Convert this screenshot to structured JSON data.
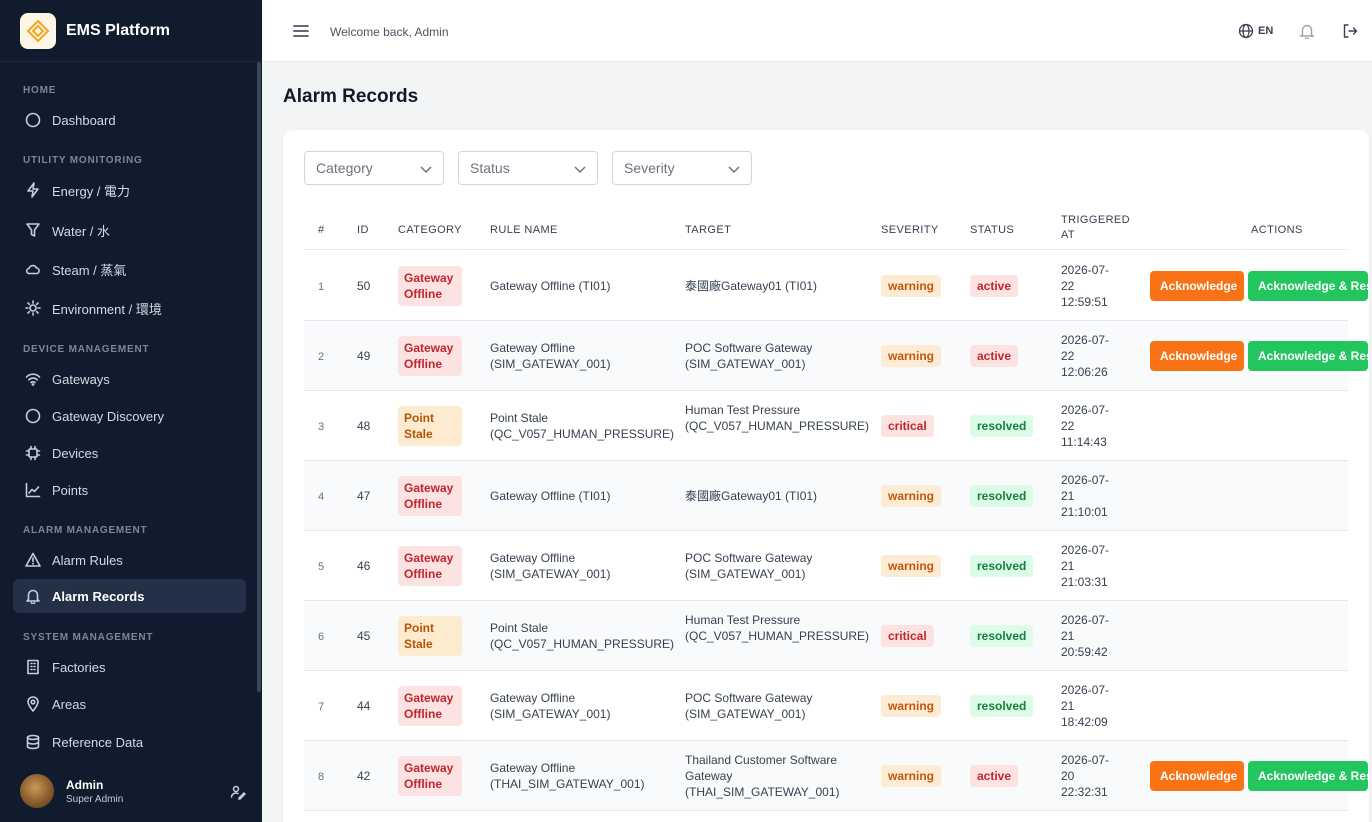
{
  "brand": {
    "name": "EMS Platform"
  },
  "sidebar": {
    "sections": [
      "HOME",
      "UTILITY MONITORING",
      "DEVICE MANAGEMENT",
      "ALARM MANAGEMENT",
      "SYSTEM MANAGEMENT"
    ],
    "items": [
      {
        "label": "Dashboard",
        "icon": "circle-icon"
      },
      {
        "label": "Energy / 電力",
        "icon": "lightning-icon"
      },
      {
        "label": "Water / 水",
        "icon": "filter-icon"
      },
      {
        "label": "Steam / 蒸氣",
        "icon": "cloud-icon"
      },
      {
        "label": "Environment / 環境",
        "icon": "sun-icon"
      },
      {
        "label": "Gateways",
        "icon": "wifi-icon"
      },
      {
        "label": "Gateway Discovery",
        "icon": "circle-icon"
      },
      {
        "label": "Devices",
        "icon": "chip-icon"
      },
      {
        "label": "Points",
        "icon": "chart-icon"
      },
      {
        "label": "Alarm Rules",
        "icon": "warning-icon"
      },
      {
        "label": "Alarm Records",
        "icon": "bell-icon",
        "active": true
      },
      {
        "label": "Factories",
        "icon": "building-icon"
      },
      {
        "label": "Areas",
        "icon": "pin-icon"
      },
      {
        "label": "Reference Data",
        "icon": "database-icon"
      }
    ]
  },
  "user": {
    "name": "Admin",
    "role": "Super Admin"
  },
  "topbar": {
    "welcome": "Welcome back, Admin",
    "lang": "EN"
  },
  "page": {
    "title": "Alarm Records"
  },
  "filters": {
    "category": "Category",
    "status": "Status",
    "severity": "Severity"
  },
  "table": {
    "headers": {
      "num": "#",
      "id": "ID",
      "category": "CATEGORY",
      "rule": "RULE NAME",
      "target": "TARGET",
      "severity": "SEVERITY",
      "status": "STATUS",
      "triggered": "TRIGGERED AT",
      "actions": "ACTIONS"
    },
    "actions": {
      "ack": "Acknowledge",
      "ack_resolve": "Acknowledge & Resolve"
    },
    "rows": [
      {
        "num": "1",
        "id": "50",
        "category": "Gateway Offline",
        "cat_tone": "red",
        "rule": "Gateway Offline (TI01)",
        "target": "泰國廠Gateway01 (TI01)",
        "severity": "warning",
        "status": "active",
        "triggered": "2026-07-22 12:59:51"
      },
      {
        "num": "2",
        "id": "49",
        "category": "Gateway Offline",
        "cat_tone": "red",
        "rule": "Gateway Offline (SIM_GATEWAY_001)",
        "target": "POC Software Gateway (SIM_GATEWAY_001)",
        "severity": "warning",
        "status": "active",
        "triggered": "2026-07-22 12:06:26"
      },
      {
        "num": "3",
        "id": "48",
        "category": "Point Stale",
        "cat_tone": "amber",
        "rule": "Point Stale (QC_V057_HUMAN_PRESSURE)",
        "target": "Human Test Pressure (QC_V057_HUMAN_PRESSURE)",
        "severity": "critical",
        "status": "resolved",
        "triggered": "2026-07-22 11:14:43"
      },
      {
        "num": "4",
        "id": "47",
        "category": "Gateway Offline",
        "cat_tone": "red",
        "rule": "Gateway Offline (TI01)",
        "target": "泰國廠Gateway01 (TI01)",
        "severity": "warning",
        "status": "resolved",
        "triggered": "2026-07-21 21:10:01"
      },
      {
        "num": "5",
        "id": "46",
        "category": "Gateway Offline",
        "cat_tone": "red",
        "rule": "Gateway Offline (SIM_GATEWAY_001)",
        "target": "POC Software Gateway (SIM_GATEWAY_001)",
        "severity": "warning",
        "status": "resolved",
        "triggered": "2026-07-21 21:03:31"
      },
      {
        "num": "6",
        "id": "45",
        "category": "Point Stale",
        "cat_tone": "amber",
        "rule": "Point Stale (QC_V057_HUMAN_PRESSURE)",
        "target": "Human Test Pressure (QC_V057_HUMAN_PRESSURE)",
        "severity": "critical",
        "status": "resolved",
        "triggered": "2026-07-21 20:59:42"
      },
      {
        "num": "7",
        "id": "44",
        "category": "Gateway Offline",
        "cat_tone": "red",
        "rule": "Gateway Offline (SIM_GATEWAY_001)",
        "target": "POC Software Gateway (SIM_GATEWAY_001)",
        "severity": "warning",
        "status": "resolved",
        "triggered": "2026-07-21 18:42:09"
      },
      {
        "num": "8",
        "id": "42",
        "category": "Gateway Offline",
        "cat_tone": "red",
        "rule": "Gateway Offline (THAI_SIM_GATEWAY_001)",
        "target": "Thailand Customer Software Gateway (THAI_SIM_GATEWAY_001)",
        "severity": "warning",
        "status": "active",
        "triggered": "2026-07-20 22:32:31"
      }
    ]
  }
}
